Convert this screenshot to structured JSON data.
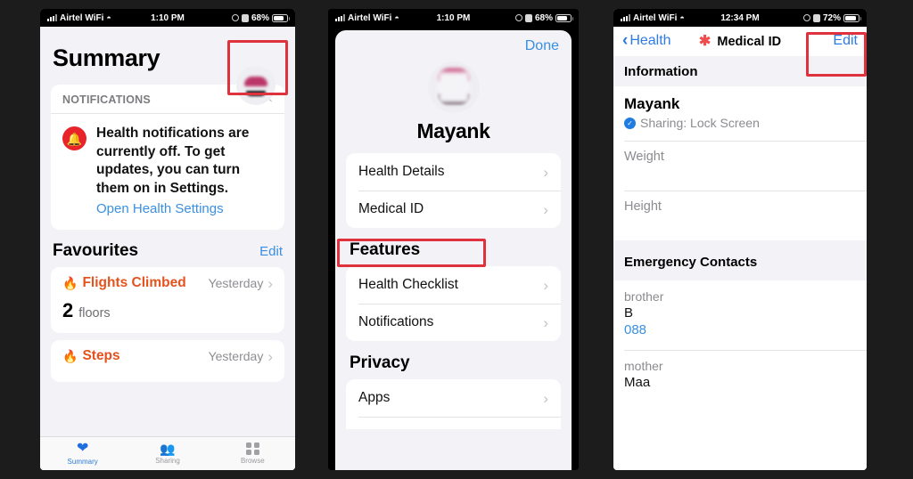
{
  "phone1": {
    "status_bar": {
      "carrier": "Airtel WiFi",
      "time": "1:10 PM",
      "battery": "68%"
    },
    "title": "Summary",
    "avatar_name": "profile-avatar",
    "notifications": {
      "header": "NOTIFICATIONS",
      "close": "×",
      "message": "Health notifications are currently off. To get updates, you can turn them on in Settings.",
      "link": "Open Health Settings"
    },
    "favourites": {
      "title": "Favourites",
      "edit": "Edit",
      "items": [
        {
          "name": "Flights Climbed",
          "when": "Yesterday",
          "value": "2",
          "unit": "floors"
        },
        {
          "name": "Steps",
          "when": "Yesterday"
        }
      ]
    },
    "tabs": [
      {
        "label": "Summary",
        "icon": "heart-icon",
        "active": true
      },
      {
        "label": "Sharing",
        "icon": "people-icon",
        "active": false
      },
      {
        "label": "Browse",
        "icon": "grid-icon",
        "active": false
      }
    ]
  },
  "phone2": {
    "status_bar": {
      "carrier": "Airtel WiFi",
      "time": "1:10 PM",
      "battery": "68%"
    },
    "done": "Done",
    "name": "Mayank",
    "profile_rows": [
      {
        "label": "Health Details"
      },
      {
        "label": "Medical ID"
      }
    ],
    "features_title": "Features",
    "feature_rows": [
      {
        "label": "Health Checklist"
      },
      {
        "label": "Notifications"
      }
    ],
    "privacy_title": "Privacy",
    "privacy_rows": [
      {
        "label": "Apps"
      }
    ]
  },
  "phone3": {
    "status_bar": {
      "carrier": "Airtel WiFi",
      "time": "12:34 PM",
      "battery": "72%"
    },
    "back": "Health",
    "nav_title": "Medical ID",
    "nav_icon": "medical-asterisk-icon",
    "edit": "Edit",
    "information_header": "Information",
    "name": "Mayank",
    "sharing": "Sharing: Lock Screen",
    "fields": [
      {
        "label": "Weight",
        "value": ""
      },
      {
        "label": "Height",
        "value": ""
      }
    ],
    "emergency_header": "Emergency Contacts",
    "contacts": [
      {
        "relation": "brother",
        "name": "B",
        "number": "088"
      },
      {
        "relation": "mother",
        "name": "Maa"
      }
    ]
  },
  "highlights": {
    "phone1_avatar": "profile-avatar-highlight",
    "phone2_medical_id": "medical-id-highlight",
    "phone3_edit": "edit-button-highlight"
  },
  "colors": {
    "accent_blue": "#3a8fe0",
    "red_highlight": "#e0313f",
    "orange": "#e4521e",
    "alert_red": "#e8242a"
  }
}
